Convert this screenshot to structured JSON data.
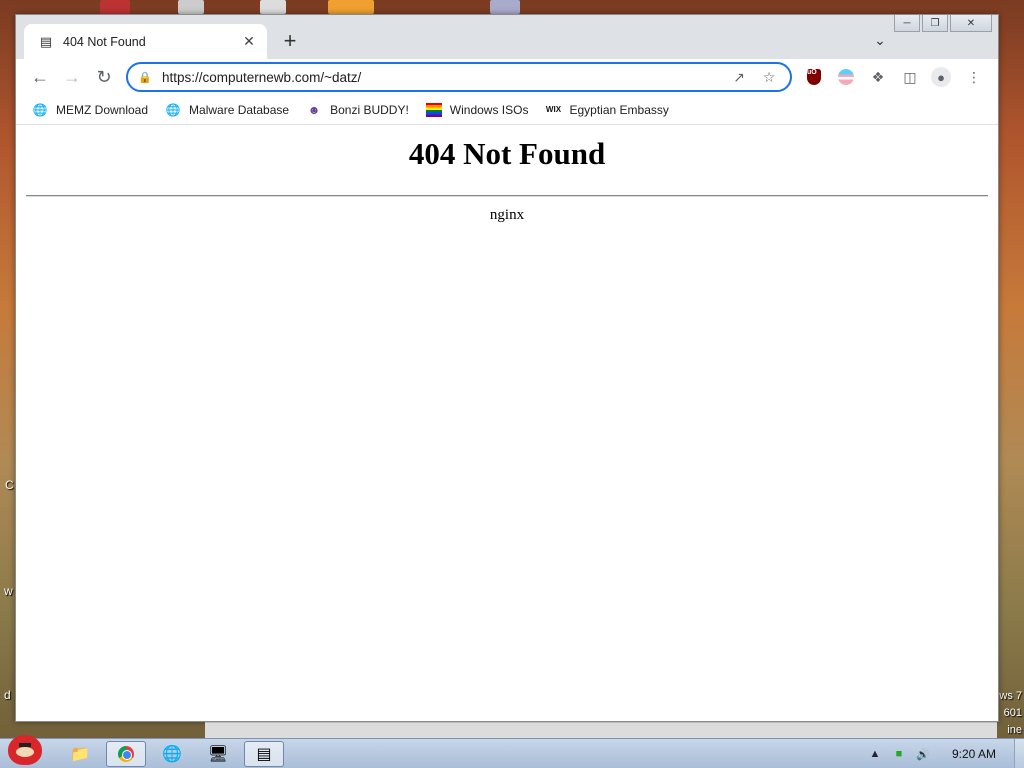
{
  "browser": {
    "tab": {
      "title": "404 Not Found"
    },
    "address_bar": {
      "url": "https://computernewb.com/~datz/"
    },
    "bookmarks": [
      {
        "label": "MEMZ Download",
        "icon": "globe-icon"
      },
      {
        "label": "Malware Database",
        "icon": "globe-icon"
      },
      {
        "label": "Bonzi BUDDY!",
        "icon": "bonzi-icon"
      },
      {
        "label": "Windows ISOs",
        "icon": "rainbow-flag-icon"
      },
      {
        "label": "Egyptian Embassy",
        "icon": "wix-icon"
      }
    ],
    "extensions": [
      "ublock-origin-icon",
      "trans-flag-icon",
      "puzzle-icon",
      "side-panel-icon",
      "profile-icon",
      "more-menu-icon"
    ]
  },
  "page": {
    "heading": "404 Not Found",
    "server": "nginx"
  },
  "taskbar": {
    "clock": "9:20 AM",
    "apps": [
      "explorer-icon",
      "chrome-icon",
      "network-icon",
      "computer-icon",
      "app-icon"
    ]
  },
  "desktop": {
    "right_fragments": [
      "ws 7",
      "601",
      "ine"
    ],
    "left_fragments": [
      "C",
      "w",
      "d"
    ]
  }
}
